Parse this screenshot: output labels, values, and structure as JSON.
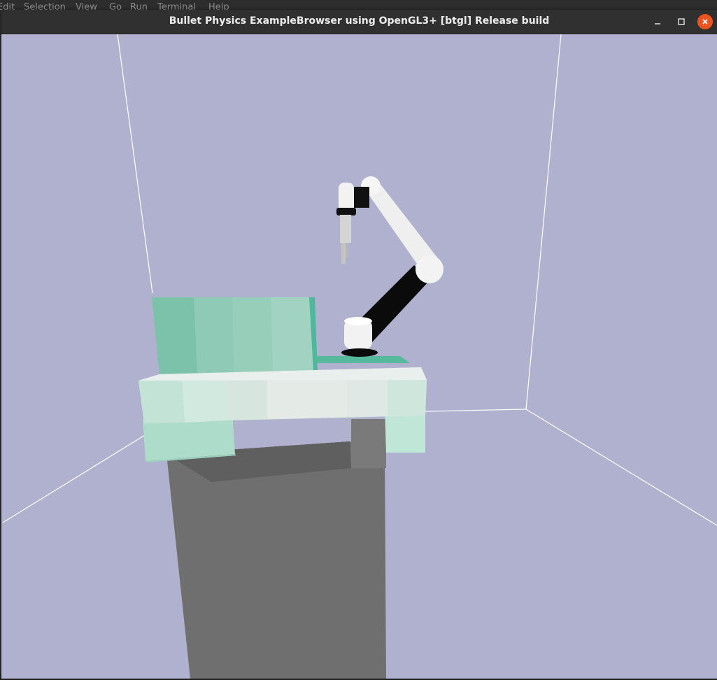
{
  "background_menubar": {
    "items": [
      "Edit",
      "Selection",
      "View",
      "Go",
      "Run",
      "Terminal",
      "Help"
    ]
  },
  "window": {
    "title": "Bullet Physics ExampleBrowser using OpenGL3+ [btgl] Release build",
    "controls": {
      "minimize": "minimize-icon",
      "maximize": "maximize-icon",
      "close": "close-icon"
    }
  },
  "colors": {
    "viewport_background": "#b0b1cf",
    "titlebar": "#303030",
    "close_button": "#e95420",
    "table_top": "#d6e6df",
    "table_back_panel": "#86c7b1",
    "table_stand": "#6f6f6f",
    "robot_links": "#f1f1f1",
    "robot_joints": "#0a0a0a"
  }
}
